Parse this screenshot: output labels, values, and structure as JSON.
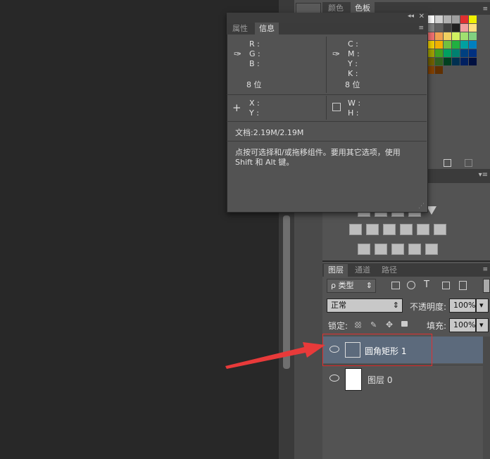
{
  "swatches_panel": {
    "tabs": [
      "颜色",
      "色板"
    ],
    "active_tab": "色板",
    "colors": [
      "#ffffff",
      "#d0d0d0",
      "#b0b0b0",
      "#a0a0a0",
      "#e03030",
      "#f0f000",
      "#808080",
      "#606060",
      "#404040",
      "#202020",
      "#f0a0a0",
      "#ffe080",
      "#f07070",
      "#f0a050",
      "#f0d060",
      "#d0f060",
      "#a0e070",
      "#80d080",
      "#f0d000",
      "#f0b000",
      "#70c040",
      "#20b040",
      "#00a0a0",
      "#0080c0",
      "#a0a000",
      "#40a020",
      "#00a060",
      "#008070",
      "#004080",
      "#003080",
      "#706000",
      "#306020",
      "#004020",
      "#003050",
      "#002060",
      "#001040",
      "#804000",
      "#603000"
    ]
  },
  "info_panel": {
    "tabs": [
      "属性",
      "信息"
    ],
    "active_tab": "信息",
    "rgb_labels": [
      "R :",
      "G :",
      "B :"
    ],
    "cmyk_labels": [
      "C :",
      "M :",
      "Y :",
      "K :"
    ],
    "bit_left": "8 位",
    "bit_right": "8 位",
    "xy_labels": [
      "X :",
      "Y :"
    ],
    "wh_labels": [
      "W :",
      "H :"
    ],
    "document_size": "文档:2.19M/2.19M",
    "hint": "点按可选择和/或拖移组件。要用其它选项，使用 Shift 和 Alt 键。"
  },
  "layers_panel": {
    "tabs": [
      "图层",
      "通道",
      "路径"
    ],
    "active_tab": "图层",
    "filter_label": "ρ 类型",
    "blend_mode": "正常",
    "opacity_label": "不透明度:",
    "opacity_value": "100%",
    "lock_label": "锁定:",
    "fill_label": "填充:",
    "fill_value": "100%",
    "layers": [
      {
        "name": "圆角矩形 1",
        "selected": true
      },
      {
        "name": "图层 0",
        "selected": false
      }
    ]
  },
  "colors": {
    "highlight_box": "#e03030",
    "arrow": "#e83a3a",
    "selected_row": "#5c6a7c"
  }
}
